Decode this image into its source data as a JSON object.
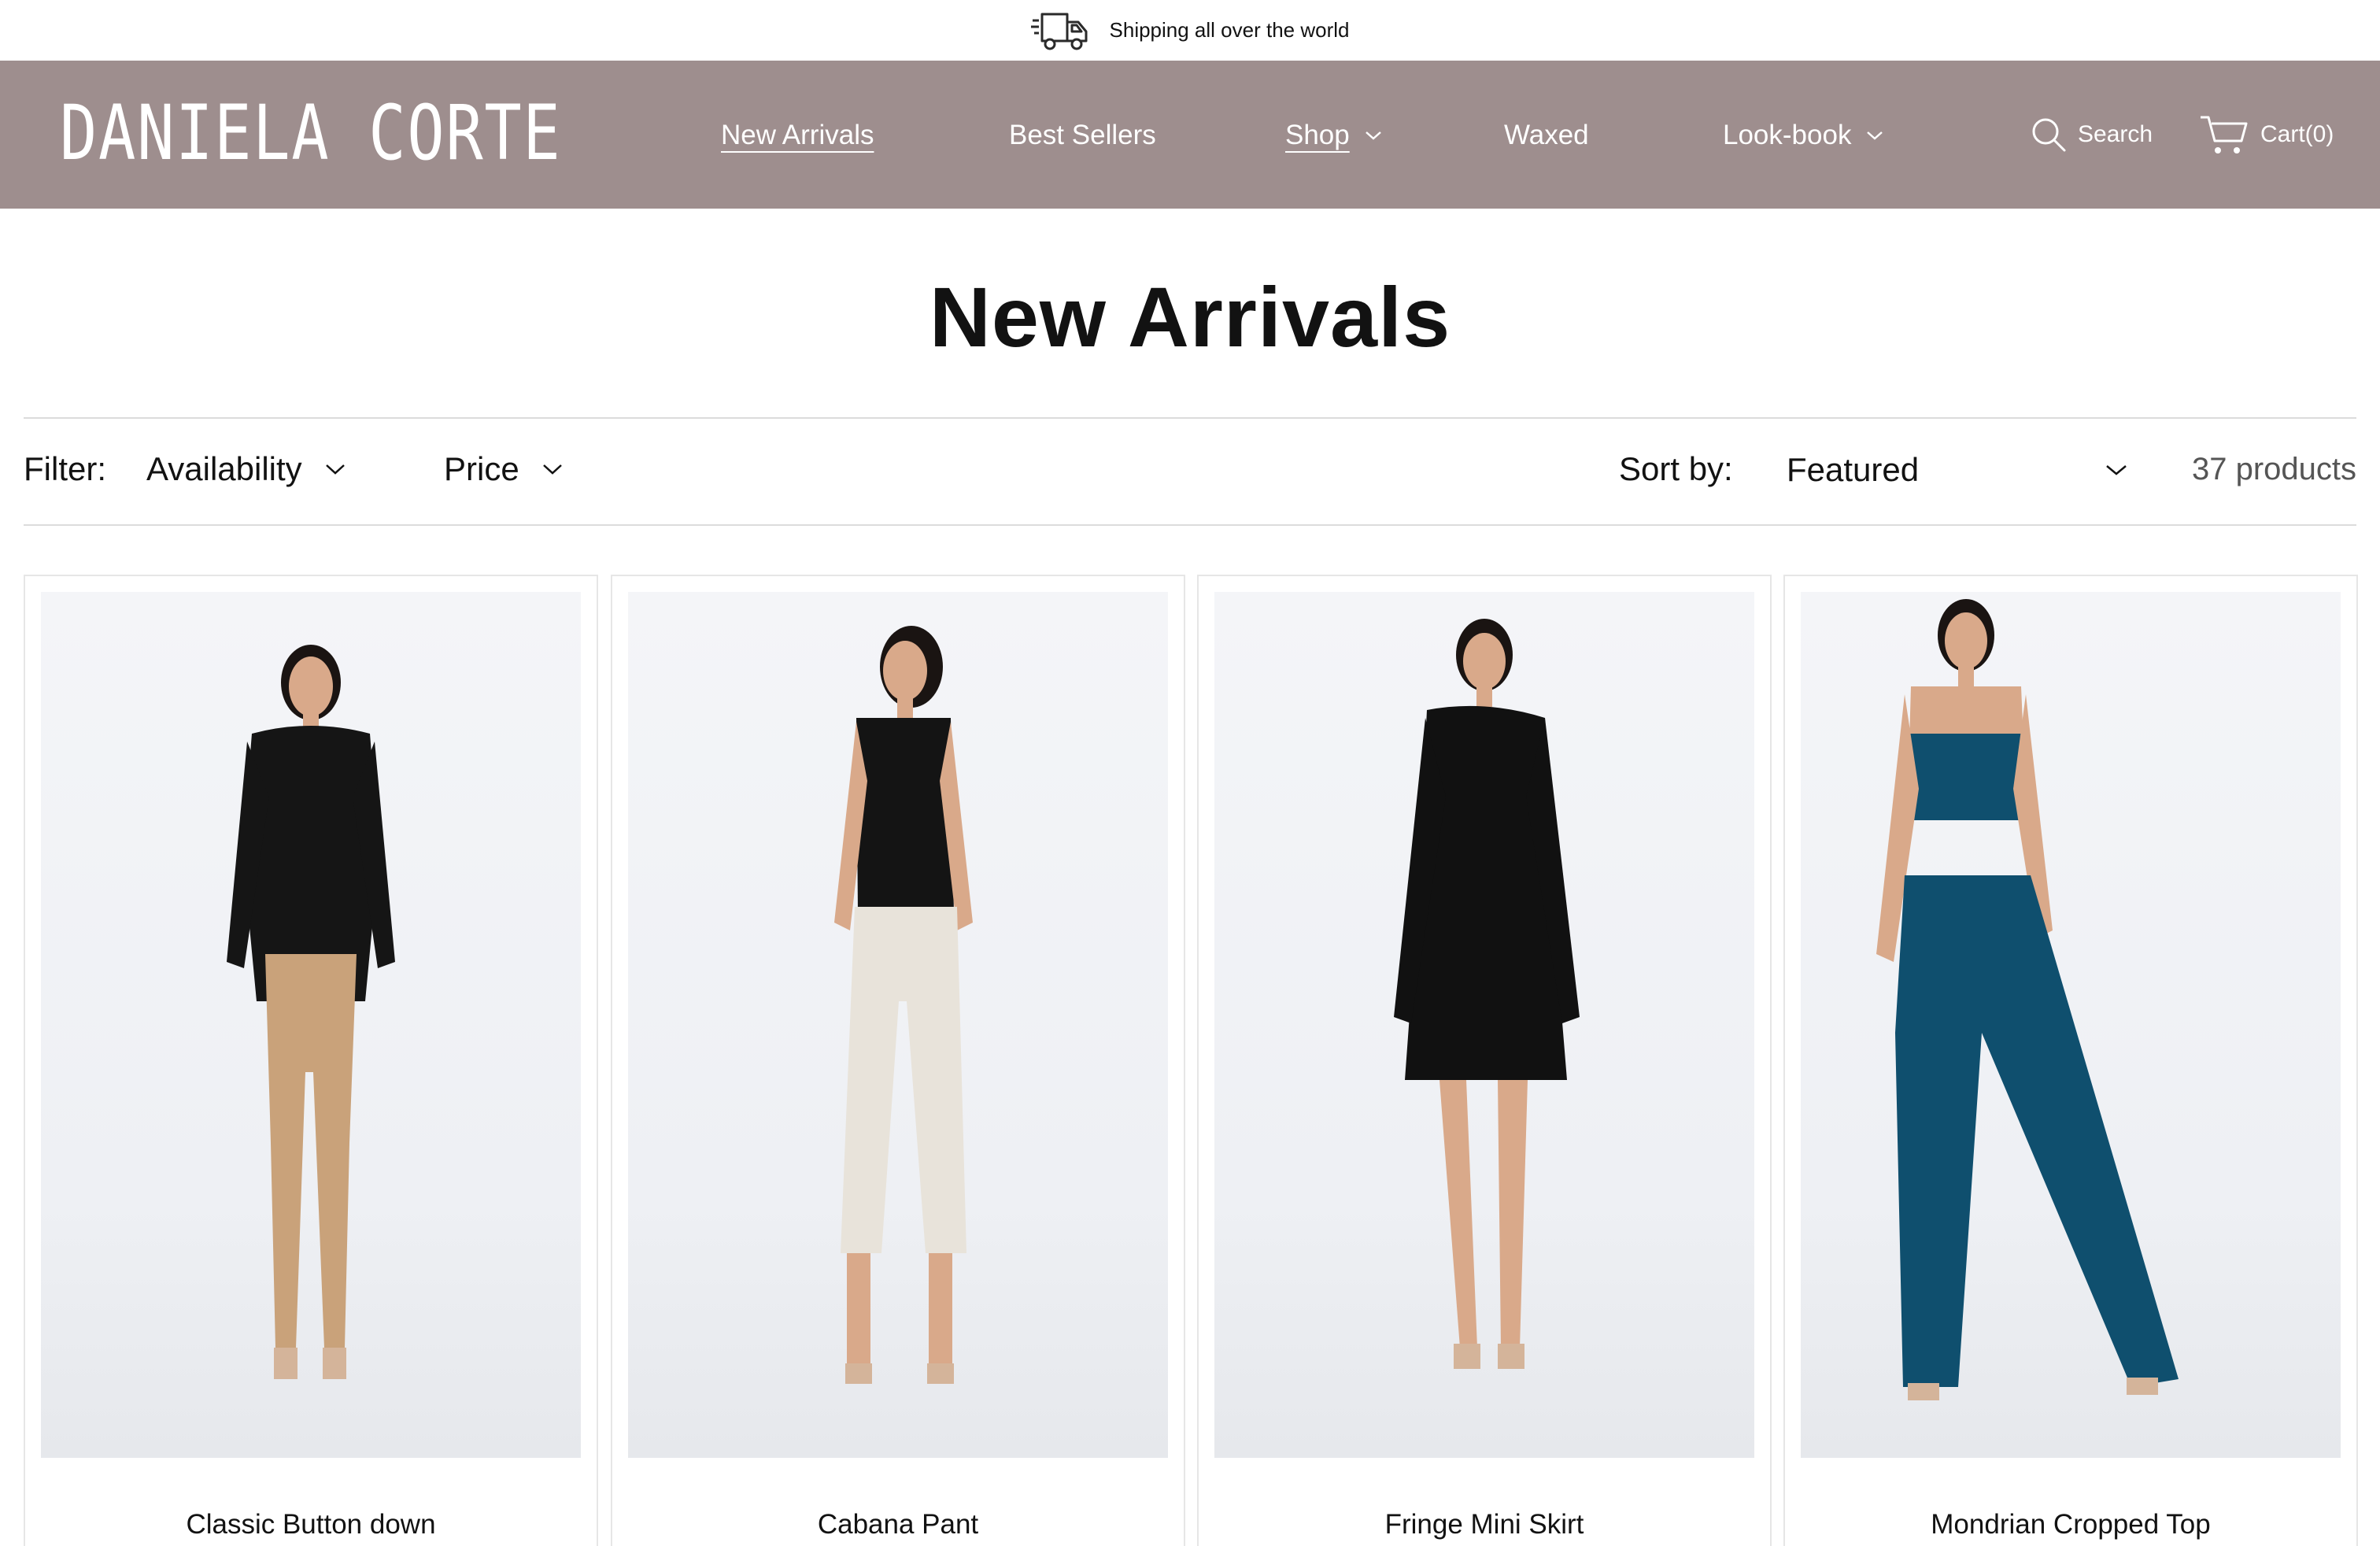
{
  "announcement": {
    "text": "Shipping all over the world",
    "icon": "truck-icon"
  },
  "header": {
    "logo": "DANIELA CORTE",
    "nav": [
      {
        "label": "New Arrivals",
        "active": true,
        "dropdown": false
      },
      {
        "label": "Best Sellers",
        "active": false,
        "dropdown": false
      },
      {
        "label": "Shop",
        "active": false,
        "dropdown": true
      },
      {
        "label": "Waxed",
        "active": false,
        "dropdown": false
      },
      {
        "label": "Look-book",
        "active": false,
        "dropdown": true
      }
    ],
    "search_label": "Search",
    "cart_label": "Cart(0)"
  },
  "page": {
    "title": "New Arrivals"
  },
  "filters": {
    "label": "Filter:",
    "availability_label": "Availability",
    "price_label": "Price",
    "sort_label": "Sort by:",
    "sort_value": "Featured",
    "count": "37 products"
  },
  "products": [
    {
      "name": "Classic Button down",
      "top_color": "#151515",
      "bottom_color": "#c9a27a"
    },
    {
      "name": "Cabana Pant",
      "top_color": "#141414",
      "bottom_color": "#e8e3da"
    },
    {
      "name": "Fringe Mini Skirt",
      "top_color": "#111111",
      "bottom_color": "#111111"
    },
    {
      "name": "Mondrian Cropped Top",
      "top_color": "#0f4f6e",
      "bottom_color": "#0f4f6e"
    }
  ],
  "colors": {
    "header_bg": "#9e8e8e",
    "text": "#121212",
    "muted": "#555555",
    "divider": "#dcdcdc"
  }
}
